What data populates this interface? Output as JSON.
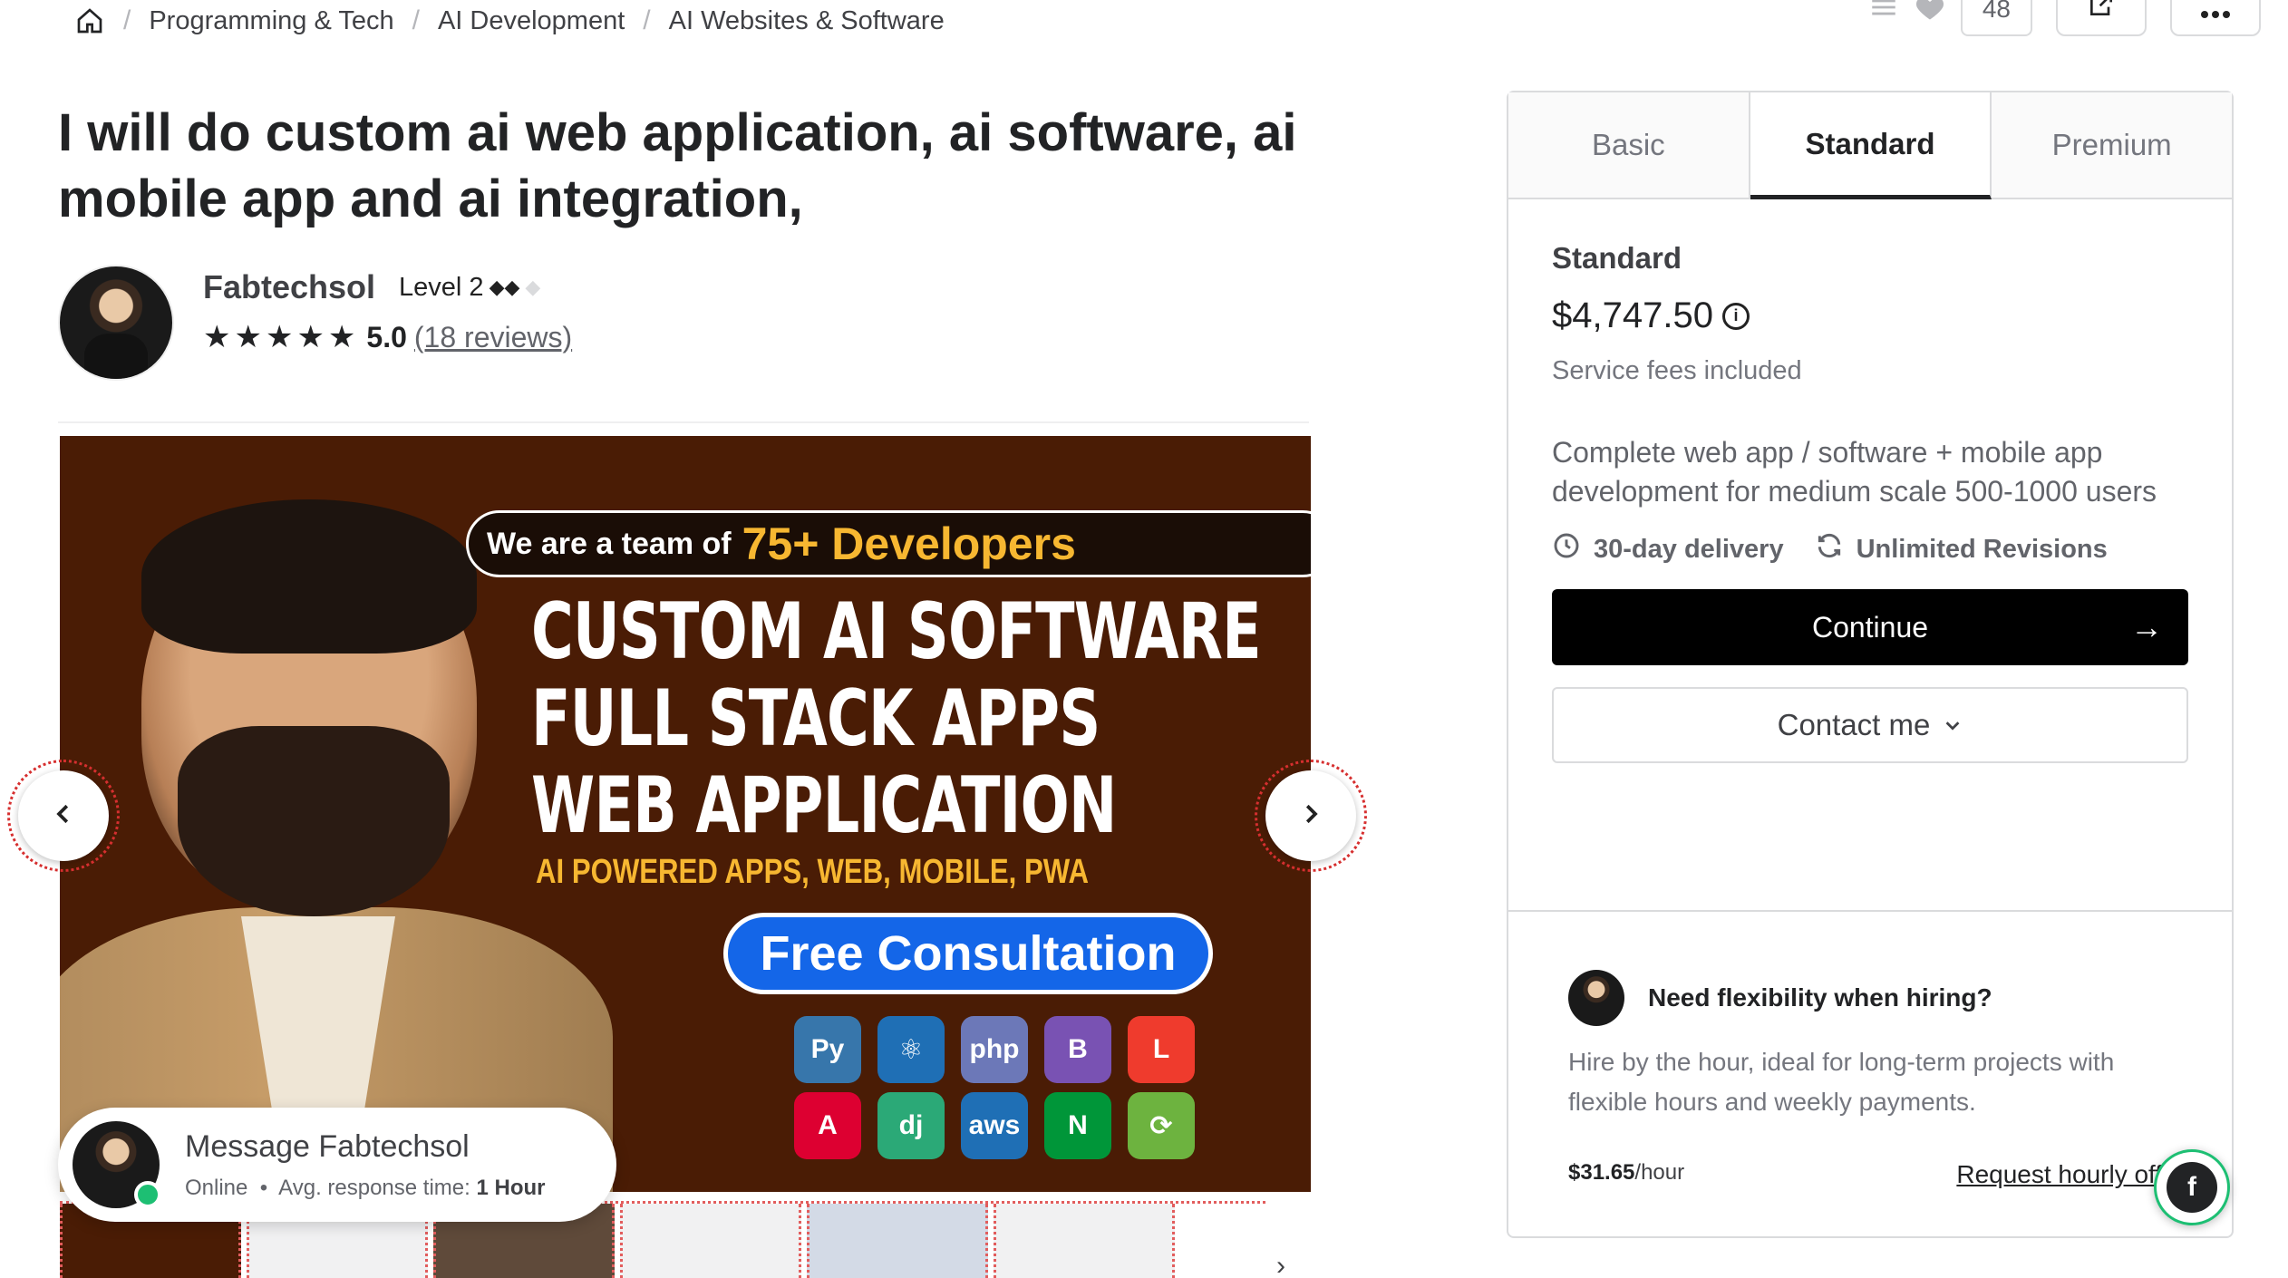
{
  "breadcrumb": {
    "home_icon": "home-icon",
    "items": [
      "Programming & Tech",
      "AI Development",
      "AI Websites & Software"
    ]
  },
  "topbar": {
    "like_count": "48",
    "icons": [
      "list-icon",
      "heart-icon",
      "share-icon",
      "more-icon"
    ]
  },
  "gig": {
    "title": "I will do custom ai web application, ai software, ai mobile app and ai integration,"
  },
  "seller": {
    "name": "Fabtechsol",
    "level": "Level 2",
    "stars": "★★★★★",
    "rating": "5.0",
    "reviews": "(18 reviews)"
  },
  "hero": {
    "pill_small": "We are a team of",
    "pill_big": "75+ Developers",
    "lines": [
      "CUSTOM AI SOFTWARE",
      "FULL STACK APPS",
      "WEB APPLICATION"
    ],
    "subline": "AI POWERED APPS, WEB, MOBILE, PWA",
    "consult": "Free Consultation",
    "tech": [
      {
        "label": "Py",
        "color": "#3776ab"
      },
      {
        "label": "⚛",
        "color": "#1f6fb5"
      },
      {
        "label": "php",
        "color": "#6c78b8"
      },
      {
        "label": "B",
        "color": "#7952b3"
      },
      {
        "label": "L",
        "color": "#ef3b2d"
      },
      {
        "label": "A",
        "color": "#dd0031"
      },
      {
        "label": "dj",
        "color": "#2ba977"
      },
      {
        "label": "aws",
        "color": "#1f6fb5"
      },
      {
        "label": "N",
        "color": "#009639"
      },
      {
        "label": "⟳",
        "color": "#6db33f"
      }
    ]
  },
  "message": {
    "title": "Message Fabtechsol",
    "status": "Online",
    "response_label": "Avg. response time:",
    "response_value": "1 Hour"
  },
  "package": {
    "tabs": [
      "Basic",
      "Standard",
      "Premium"
    ],
    "active_tab": "Standard",
    "name": "Standard",
    "price": "$4,747.50",
    "fees": "Service fees included",
    "description": "Complete web app / software + mobile app development for medium scale 500-1000 users",
    "delivery": "30-day delivery",
    "revisions": "Unlimited Revisions",
    "continue_label": "Continue",
    "contact_label": "Contact me"
  },
  "flexibility": {
    "title": "Need flexibility when hiring?",
    "description": "Hire by the hour, ideal for long-term projects with flexible hours and weekly payments.",
    "rate": "$31.65",
    "rate_unit": "/hour",
    "request_label": "Request hourly offer"
  }
}
